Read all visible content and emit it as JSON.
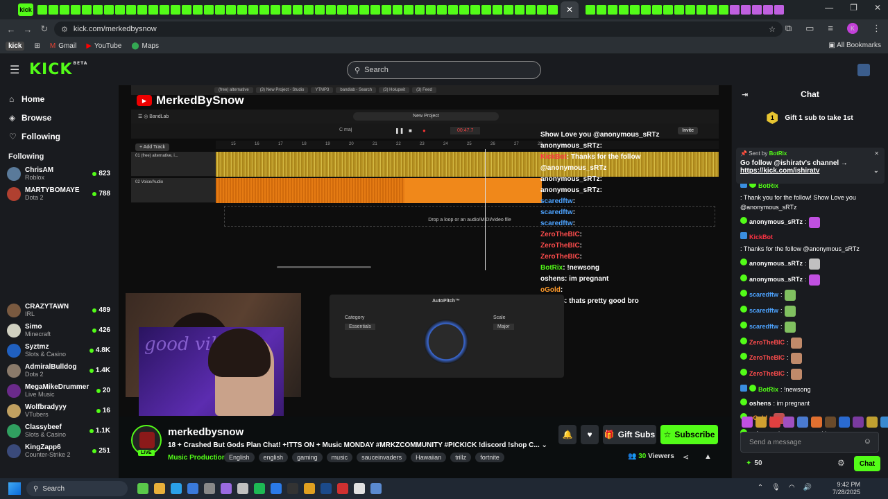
{
  "browser": {
    "tab_label": "kick",
    "url": "kick.com/merkedbysnow",
    "bookmarks": [
      {
        "label": "kick"
      },
      {
        "label": "Gmail"
      },
      {
        "label": "YouTube"
      },
      {
        "label": "Maps"
      }
    ],
    "all_bookmarks": "All Bookmarks",
    "profile_initial": "K"
  },
  "header": {
    "logo": "KICK",
    "logo_sup": "BETA",
    "search_placeholder": "Search"
  },
  "sidebar": {
    "nav": [
      {
        "label": "Home",
        "icon": "home-icon"
      },
      {
        "label": "Browse",
        "icon": "compass-icon"
      },
      {
        "label": "Following",
        "icon": "heart-icon"
      }
    ],
    "following_title": "Following",
    "following": [
      {
        "name": "ChrisAM",
        "category": "Roblox",
        "viewers": "823",
        "color": "#5a7a9a"
      },
      {
        "name": "MARTYBOMAYE",
        "category": "Dota 2",
        "viewers": "788",
        "color": "#b04030"
      },
      {
        "name": "CRAZYTAWN",
        "category": "IRL",
        "viewers": "489",
        "color": "#7a5a40"
      },
      {
        "name": "Simo",
        "category": "Minecraft",
        "viewers": "426",
        "color": "#d0d0c0"
      },
      {
        "name": "Syztmz",
        "category": "Slots & Casino",
        "viewers": "4.8K",
        "color": "#2060c0"
      },
      {
        "name": "AdmiralBulldog",
        "category": "Dota 2",
        "viewers": "1.4K",
        "color": "#8a7a6a"
      },
      {
        "name": "MegaMikeDrummer",
        "category": "Live Music",
        "viewers": "20",
        "color": "#6a2a8a"
      },
      {
        "name": "Wolfbradyyy",
        "category": "VTubers",
        "viewers": "16",
        "color": "#c0a060"
      },
      {
        "name": "Classybeef",
        "category": "Slots & Casino",
        "viewers": "1.1K",
        "color": "#30a060"
      },
      {
        "name": "KingZapp6",
        "category": "Counter-Strike 2",
        "viewers": "251",
        "color": "#3a4a7a"
      }
    ]
  },
  "video": {
    "yt_channel": "MerkedBySnow",
    "bandlab": "BandLab",
    "project": "New Project",
    "key": "C maj",
    "time": "00:47.7",
    "invite": "Invite",
    "add_track": "+ Add Track",
    "track1": "01 (free) alternative, i...",
    "track2": "02 Voice/Audio",
    "drop_text": "Drop a loop or an audio/MIDI/video file",
    "autopitch": "AutoPitch™",
    "autopitch_category": "Category",
    "autopitch_scale": "Scale",
    "autopitch_scale_value": "Major",
    "autopitch_essentials": "Essentials",
    "ruler": [
      "15",
      "16",
      "17",
      "18",
      "19",
      "20",
      "21",
      "22",
      "23",
      "24",
      "25",
      "26",
      "27",
      "28"
    ],
    "overlay_chat": [
      {
        "user": "",
        "text": "Show Love you @anonymous_sRTz",
        "color": "#ffffff"
      },
      {
        "user": "anonymous_sRTz",
        "text": ":",
        "color": "#ffffff"
      },
      {
        "user": "KickBot",
        "text": ": Thanks for the follow",
        "color": "#ff3344"
      },
      {
        "user": "",
        "text": "@anonymous_sRTz",
        "color": "#ffffff"
      },
      {
        "user": "anonymous_sRTz",
        "text": ":",
        "color": "#ffffff"
      },
      {
        "user": "anonymous_sRTz",
        "text": ":",
        "color": "#ffffff"
      },
      {
        "user": "scaredftw",
        "text": ":",
        "color": "#4da3ff"
      },
      {
        "user": "scaredftw",
        "text": ":",
        "color": "#4da3ff"
      },
      {
        "user": "scaredftw",
        "text": ":",
        "color": "#4da3ff"
      },
      {
        "user": "ZeroTheBIC",
        "text": ":",
        "color": "#ff4d4d"
      },
      {
        "user": "ZeroTheBIC",
        "text": ":",
        "color": "#ff4d4d"
      },
      {
        "user": "ZeroTheBIC",
        "text": ":",
        "color": "#ff4d4d"
      },
      {
        "user": "BotRix",
        "text": ": !newsong",
        "color": "#53fc18"
      },
      {
        "user": "oshens",
        "text": ": im pregnant",
        "color": "#ffffff"
      },
      {
        "user": "oGold",
        "text": ":",
        "color": "#ff9a2a"
      },
      {
        "user": "oshens",
        "text": ": thats pretty good bro",
        "color": "#ffffff"
      }
    ]
  },
  "channel": {
    "name": "merkedbysnow",
    "live": "LIVE",
    "title": "18 + Crashed But Gods Plan Chat! +!TTS ON + Music MONDAY #MRKZCOMMUNITY #PICKICK !discord !shop C...",
    "category": "Music Production",
    "tags": [
      "English",
      "english",
      "gaming",
      "music",
      "sauceinvaders",
      "Hawaiian",
      "trillz",
      "fortnite"
    ],
    "gift_subs": "Gift Subs",
    "subscribe": "Subscribe",
    "viewers": "30",
    "viewers_label": "Viewers"
  },
  "chat": {
    "title": "Chat",
    "gift_rank": "1",
    "gift_text": "Gift 1 sub to take 1st",
    "pinned_by_label": "Sent by",
    "pinned_by": "BotRix",
    "pinned_msg": "Go follow @ishiratv's channel →",
    "pinned_link": "https://kick.com/ishiratv",
    "messages": [
      {
        "user": "BotRix",
        "text": ": Thank you for the follow! Show Love you @anonymous_sRTz",
        "color": "#53fc18",
        "emote": ""
      },
      {
        "user": "anonymous_sRTz",
        "text": ":",
        "color": "#ffffff",
        "emote": "#c050e0"
      },
      {
        "user": "KickBot",
        "text": ": Thanks for the follow @anonymous_sRTz",
        "color": "#ff3344",
        "emote": ""
      },
      {
        "user": "anonymous_sRTz",
        "text": ":",
        "color": "#ffffff",
        "emote": "#c0c0c0"
      },
      {
        "user": "anonymous_sRTz",
        "text": ":",
        "color": "#ffffff",
        "emote": "#c050e0"
      },
      {
        "user": "scaredftw",
        "text": ":",
        "color": "#4da3ff",
        "emote": "#80c060"
      },
      {
        "user": "scaredftw",
        "text": ":",
        "color": "#4da3ff",
        "emote": "#80c060"
      },
      {
        "user": "scaredftw",
        "text": ":",
        "color": "#4da3ff",
        "emote": "#80c060"
      },
      {
        "user": "ZeroTheBIC",
        "text": ":",
        "color": "#ff4d4d",
        "emote": "#c08a6a"
      },
      {
        "user": "ZeroTheBIC",
        "text": ":",
        "color": "#ff4d4d",
        "emote": "#c08a6a"
      },
      {
        "user": "ZeroTheBIC",
        "text": ":",
        "color": "#ff4d4d",
        "emote": "#c08a6a"
      },
      {
        "user": "BotRix",
        "text": ": !newsong",
        "color": "#53fc18",
        "emote": ""
      },
      {
        "user": "oshens",
        "text": ": im pregnant",
        "color": "#ffffff",
        "emote": ""
      },
      {
        "user": "oGold",
        "text": ":",
        "color": "#ff9a2a",
        "emote": "#c05050"
      },
      {
        "user": "oshens",
        "text": ": thats pretty good bro",
        "color": "#ffffff",
        "emote": ""
      }
    ],
    "input_placeholder": "Send a message",
    "points": "50",
    "send": "Chat"
  },
  "taskbar": {
    "search": "Search",
    "time": "9:42 PM",
    "date": "7/28/2025"
  },
  "colors": {
    "accent": "#53fc18",
    "bg": "#0b0e0f",
    "panel": "#191b1f"
  }
}
